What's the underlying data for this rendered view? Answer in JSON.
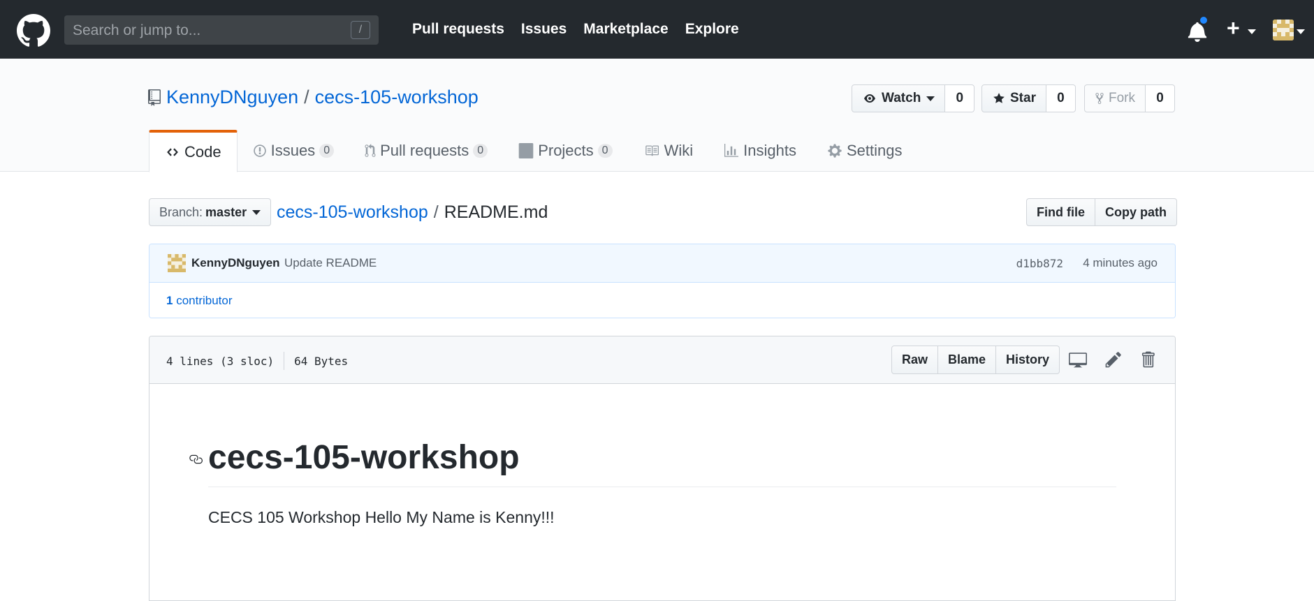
{
  "header": {
    "search_placeholder": "Search or jump to...",
    "slash_key": "/",
    "nav": [
      "Pull requests",
      "Issues",
      "Marketplace",
      "Explore"
    ],
    "plus": "+"
  },
  "repo": {
    "owner": "KennyDNguyen",
    "separator": "/",
    "name": "cecs-105-workshop",
    "watch_label": "Watch",
    "watch_count": "0",
    "star_label": "Star",
    "star_count": "0",
    "fork_label": "Fork",
    "fork_count": "0"
  },
  "tabs": [
    {
      "label": "Code",
      "counter": null
    },
    {
      "label": "Issues",
      "counter": "0"
    },
    {
      "label": "Pull requests",
      "counter": "0"
    },
    {
      "label": "Projects",
      "counter": "0"
    },
    {
      "label": "Wiki",
      "counter": null
    },
    {
      "label": "Insights",
      "counter": null
    },
    {
      "label": "Settings",
      "counter": null
    }
  ],
  "file_nav": {
    "branch_label": "Branch:",
    "branch_value": "master",
    "crumb_repo": "cecs-105-workshop",
    "crumb_sep": "/",
    "crumb_file": "README.md",
    "find_file": "Find file",
    "copy_path": "Copy path"
  },
  "commit": {
    "author": "KennyDNguyen",
    "message": "Update README",
    "sha": "d1bb872",
    "time": "4 minutes ago",
    "contributors_count": "1",
    "contributors_label": "contributor"
  },
  "file": {
    "lines": "4 lines (3 sloc)",
    "size": "64 Bytes",
    "raw": "Raw",
    "blame": "Blame",
    "history": "History"
  },
  "readme": {
    "heading": "cecs-105-workshop",
    "body": "CECS 105 Workshop Hello My Name is Kenny!!!"
  },
  "colors": {
    "header_bg": "#24292e",
    "link": "#0366d6",
    "tab_accent": "#e36209",
    "notification_dot": "#2188ff"
  }
}
